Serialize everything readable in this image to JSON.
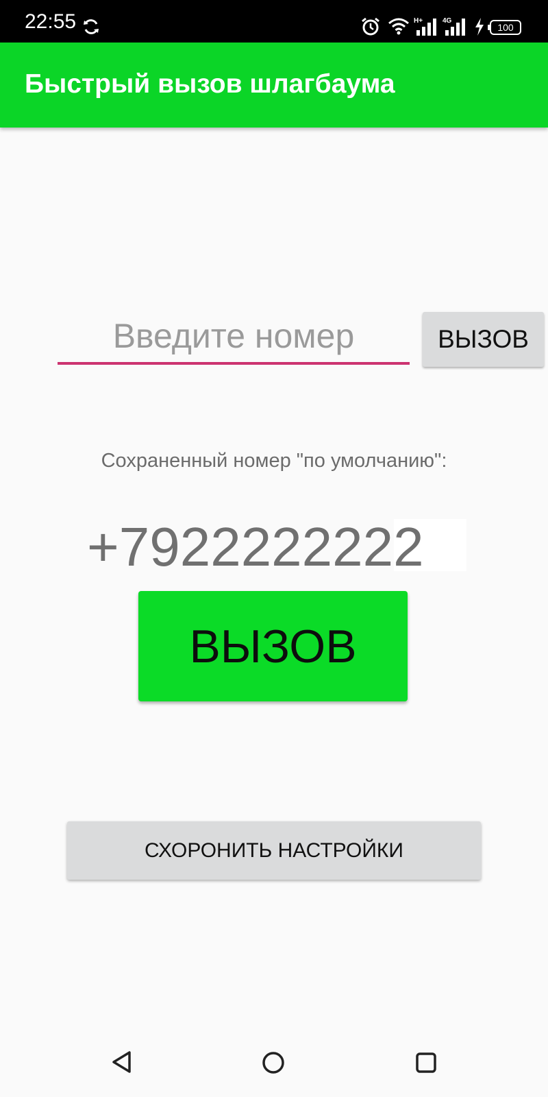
{
  "status_bar": {
    "time": "22:55",
    "icons": [
      "sync-icon",
      "alarm-icon",
      "wifi-icon",
      "signal-h-plus-icon",
      "signal-4g-icon",
      "charging-icon",
      "battery-icon"
    ],
    "network_1": "H+",
    "network_2": "4G",
    "battery_level": "100"
  },
  "app_bar": {
    "title": "Быстрый вызов шлагбаума",
    "color": "#0bd527"
  },
  "number_input": {
    "value": "",
    "placeholder": "Введите номер",
    "underline_color": "#cc3370"
  },
  "small_call_button": {
    "label": "ВЫЗОВ"
  },
  "saved": {
    "label": "Сохраненный номер \"по умолчанию\":",
    "number": "+7922222222"
  },
  "big_call_button": {
    "label": "ВЫЗОВ",
    "color": "#0bdb27"
  },
  "save_settings_button": {
    "label": "СХОРОНИТЬ НАСТРОЙКИ"
  },
  "nav_bar": {
    "icons": [
      "back-icon",
      "home-icon",
      "recents-icon"
    ]
  }
}
